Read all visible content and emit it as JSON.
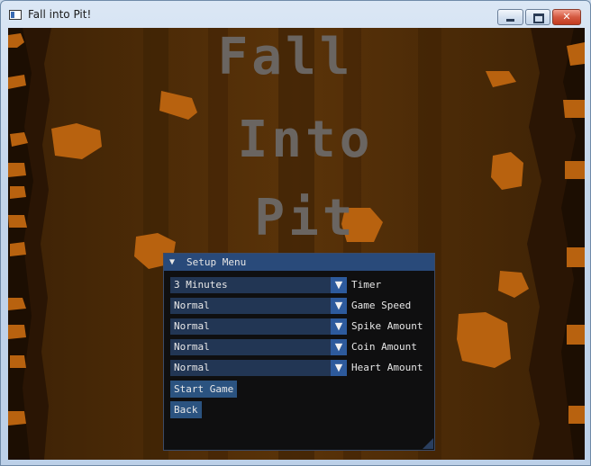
{
  "window": {
    "title": "Fall into Pit!",
    "close_glyph": "✕"
  },
  "icons": {
    "app": "app-window-icon",
    "minimize": "minimize-icon",
    "maximize": "maximize-icon",
    "close": "close-icon",
    "collapse": "triangle-down-icon",
    "dropdown": "triangle-down-icon"
  },
  "game": {
    "logo_lines": [
      "Fall",
      "Into",
      "Pit"
    ],
    "colors": {
      "background": "#4a2a07",
      "wall": "#2a1504",
      "ore": "#b8620f",
      "logo": "#6a6561"
    }
  },
  "setup_menu": {
    "title": "Setup Menu",
    "collapse_glyph": "▼",
    "dropdown_glyph": "▼",
    "rows": [
      {
        "value": "3 Minutes",
        "label": "Timer"
      },
      {
        "value": "Normal",
        "label": "Game Speed"
      },
      {
        "value": "Normal",
        "label": "Spike Amount"
      },
      {
        "value": "Normal",
        "label": "Coin Amount"
      },
      {
        "value": "Normal",
        "label": "Heart Amount"
      }
    ],
    "start_button": "Start Game",
    "back_button": "Back",
    "colors": {
      "panel_bg": "#0f0f10",
      "header": "#294a7a",
      "combo": "#223654",
      "arrow": "#2d5a9c",
      "button": "#2b5380"
    }
  }
}
